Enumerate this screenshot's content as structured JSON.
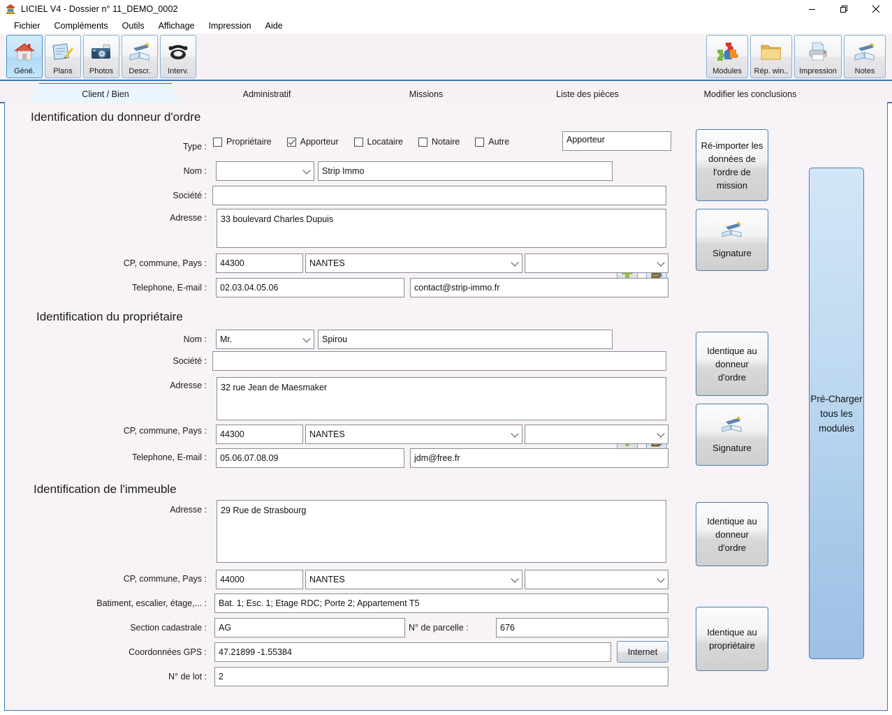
{
  "window": {
    "title": "LICIEL V4 - Dossier n° 11_DEMO_0002",
    "app_icon": "liciel-house-icon",
    "controls": {
      "minimize": "–",
      "restore": "❐",
      "close": "✕"
    }
  },
  "menubar": {
    "items": [
      {
        "label": "Fichier"
      },
      {
        "label": "Compléments"
      },
      {
        "label": "Outils"
      },
      {
        "label": "Affichage"
      },
      {
        "label": "Impression"
      },
      {
        "label": "Aide"
      }
    ]
  },
  "toolbar": {
    "left": [
      {
        "label": "Géné.",
        "icon": "house-icon",
        "active": true
      },
      {
        "label": "Plans",
        "icon": "blueprint-pencil-icon",
        "active": false
      },
      {
        "label": "Photos",
        "icon": "camera-icon",
        "active": false
      },
      {
        "label": "Descr.",
        "icon": "open-book-icon",
        "active": false
      },
      {
        "label": "Interv.",
        "icon": "telephone-icon",
        "active": false
      }
    ],
    "right": [
      {
        "label": "Modules",
        "icon": "puzzle-pieces-icon"
      },
      {
        "label": "Rép. win..",
        "icon": "folder-icon"
      },
      {
        "label": "Impression",
        "icon": "printer-icon"
      },
      {
        "label": "Notes",
        "icon": "notes-books-icon"
      }
    ]
  },
  "tabs": [
    {
      "label": "Client / Bien",
      "active": true
    },
    {
      "label": "Administratif",
      "active": false
    },
    {
      "label": "Missions",
      "active": false
    },
    {
      "label": "Liste des pièces",
      "active": false
    },
    {
      "label": "Modifier les conclusions",
      "active": false
    }
  ],
  "sections": {
    "donneur": {
      "title": "Identification du donneur d'ordre",
      "type_label": "Type :",
      "type_options": [
        {
          "label": "Propriétaire",
          "checked": false
        },
        {
          "label": "Apporteur",
          "checked": true
        },
        {
          "label": "Locataire",
          "checked": false
        },
        {
          "label": "Notaire",
          "checked": false
        },
        {
          "label": "Autre",
          "checked": false
        }
      ],
      "type_value": "Apporteur",
      "nom_label": "Nom :",
      "civilite_value": "",
      "nom_value": "Strip Immo",
      "societe_label": "Société :",
      "societe_value": "",
      "adresse_label": "Adresse :",
      "adresse_value": "33 boulevard Charles Dupuis",
      "cp_label": "CP, commune, Pays :",
      "cp_value": "44300",
      "commune_value": "NANTES",
      "pays_value": "",
      "tel_label": "Telephone, E-mail :",
      "tel_value": "02.03.04.05.06",
      "email_value": "contact@strip-immo.fr",
      "add_icon": "green-plus-icon",
      "contact_icon": "address-book-icon"
    },
    "proprietaire": {
      "title": "Identification du propriétaire",
      "nom_label": "Nom :",
      "civilite_value": "Mr.",
      "nom_value": "Spirou",
      "societe_label": "Société :",
      "societe_value": "",
      "adresse_label": "Adresse :",
      "adresse_value": "32 rue Jean de Maesmaker",
      "cp_label": "CP, commune, Pays :",
      "cp_value": "44300",
      "commune_value": "NANTES",
      "pays_value": "",
      "tel_label": "Telephone, E-mail :",
      "tel_value": "05.06.07.08.09",
      "email_value": "jdm@free.fr",
      "add_icon": "green-plus-icon",
      "contact_icon": "address-book-icon"
    },
    "immeuble": {
      "title": "Identification de l'immeuble",
      "adresse_label": "Adresse :",
      "adresse_value": "29 Rue de Strasbourg",
      "cp_label": "CP, commune, Pays :",
      "cp_value": "44000",
      "commune_value": "NANTES",
      "pays_value": "",
      "batiment_label": "Batiment, escalier, étage,... :",
      "batiment_value": "Bat. 1; Esc. 1; Etage RDC; Porte 2; Appartement T5",
      "section_label": "Section cadastrale :",
      "section_value": "AG",
      "parcelle_label": "N° de parcelle :",
      "parcelle_value": "676",
      "gps_label": "Coordonnées GPS :",
      "gps_value": "47.21899 -1.55384",
      "internet_label": "Internet",
      "lot_label": "N° de lot :",
      "lot_value": "2"
    }
  },
  "actions": {
    "reimport": "Ré-importer les données de l'ordre de mission",
    "signature1": "Signature",
    "identique_donneur1": "Identique au donneur d'ordre",
    "signature2": "Signature",
    "identique_donneur2": "Identique au donneur d'ordre",
    "identique_proprietaire": "Identique au propriétaire",
    "precharger": "Pré-Charger tous les modules",
    "signature_icon": "signature-pen-icon"
  },
  "colors": {
    "accent_blue": "#3b78ae",
    "panel_bg": "#f8f3f6",
    "toolbar_bg": "#f6f1f4",
    "active_tab_bg": "#eaf5fd",
    "preload_blue": "#a8c9e9"
  }
}
